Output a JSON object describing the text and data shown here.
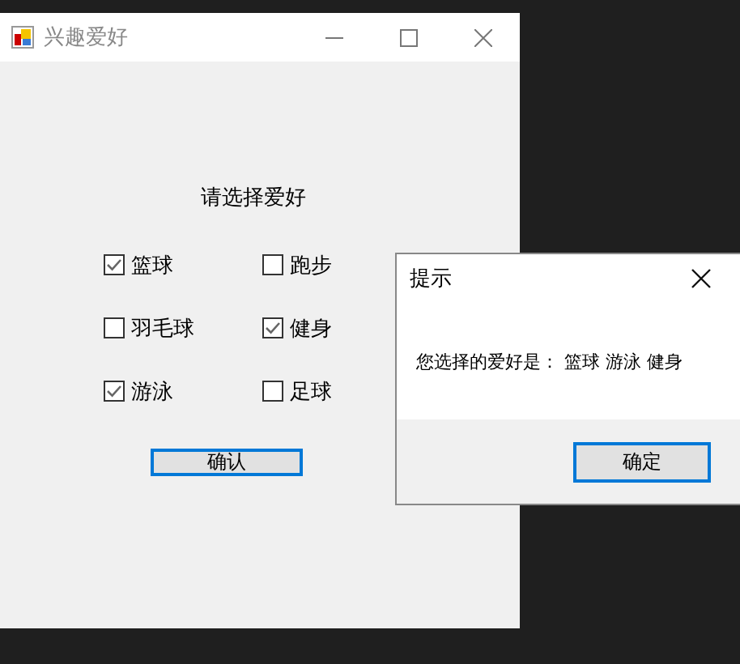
{
  "main_window": {
    "title": "兴趣爱好",
    "prompt": "请选择爱好",
    "hobbies": [
      {
        "label": "篮球",
        "checked": true
      },
      {
        "label": "跑步",
        "checked": false
      },
      {
        "label": "羽毛球",
        "checked": false
      },
      {
        "label": "健身",
        "checked": true
      },
      {
        "label": "游泳",
        "checked": true
      },
      {
        "label": "足球",
        "checked": false
      }
    ],
    "confirm_button": "确认"
  },
  "dialog": {
    "title": "提示",
    "message": "您选择的爱好是：  篮球 游泳 健身",
    "ok_button": "确定"
  }
}
